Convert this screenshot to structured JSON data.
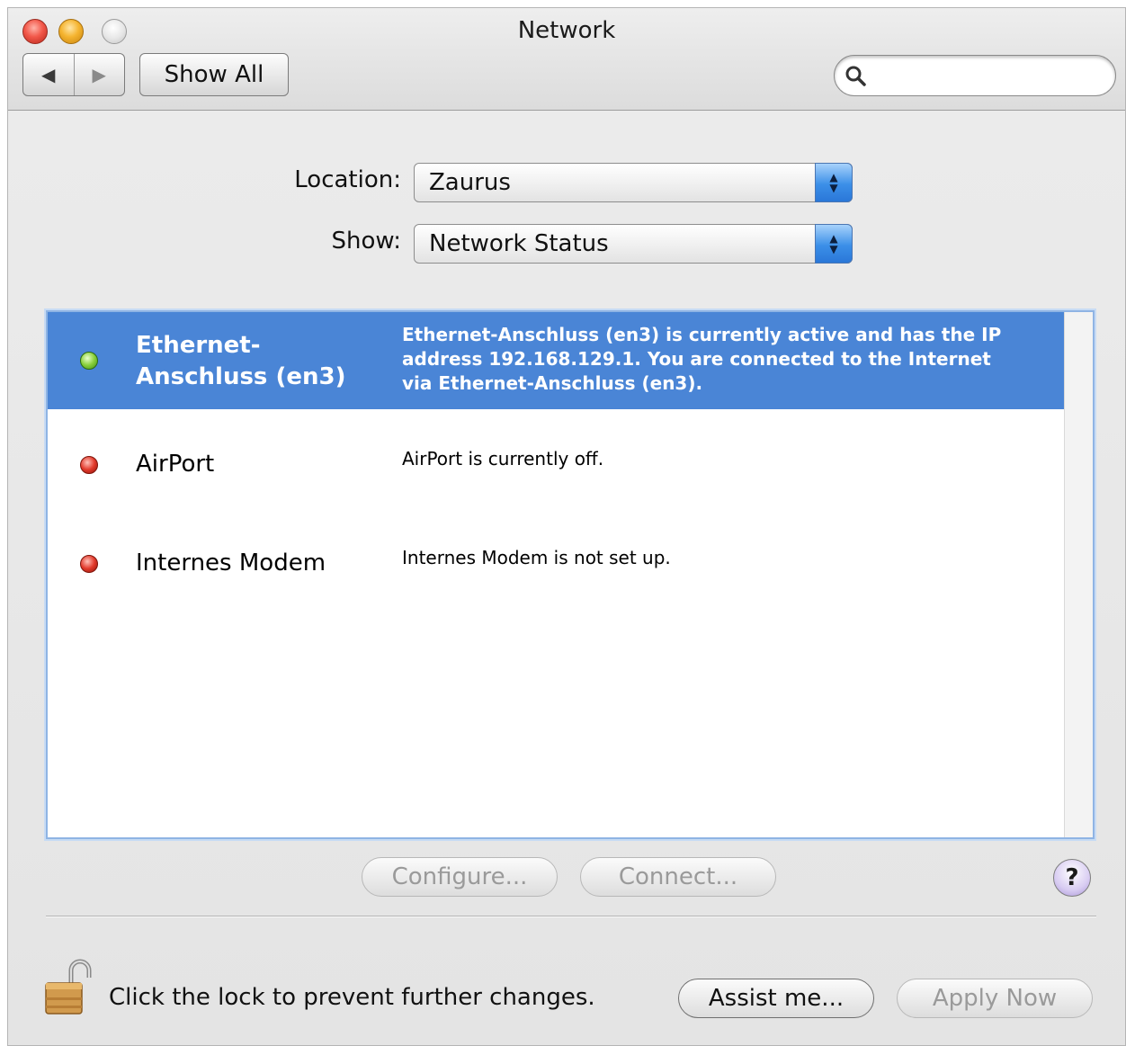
{
  "window": {
    "title": "Network"
  },
  "toolbar": {
    "back_icon": "◀",
    "forward_icon": "▶",
    "show_all_label": "Show All",
    "search_value": "",
    "search_placeholder": ""
  },
  "location": {
    "label": "Location:",
    "value": "Zaurus"
  },
  "show": {
    "label": "Show:",
    "value": "Network Status"
  },
  "services": [
    {
      "name": "Ethernet-Anschluss (en3)",
      "status": "green",
      "selected": true,
      "description": "Ethernet-Anschluss (en3) is currently active and has the IP address 192.168.129.1. You are connected to the Internet via Ethernet-Anschluss (en3)."
    },
    {
      "name": "AirPort",
      "status": "red",
      "selected": false,
      "description": "AirPort is currently off."
    },
    {
      "name": "Internes Modem",
      "status": "red",
      "selected": false,
      "description": "Internes Modem is not set up."
    }
  ],
  "actions": {
    "configure_label": "Configure...",
    "connect_label": "Connect...",
    "help_label": "?"
  },
  "footer": {
    "lock_text": "Click the lock to prevent further changes.",
    "assist_label": "Assist me...",
    "apply_label": "Apply Now"
  },
  "colors": {
    "selection": "#4a85d6",
    "status_green": "#88cf3a",
    "status_red": "#e23a2c"
  }
}
